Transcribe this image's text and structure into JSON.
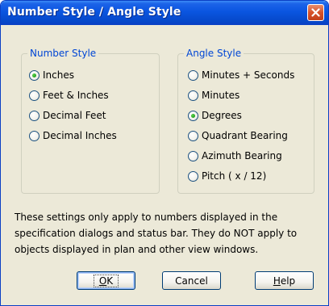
{
  "window": {
    "title": "Number Style / Angle Style"
  },
  "number_style": {
    "label": "Number Style",
    "selected": "Inches",
    "options": [
      "Inches",
      "Feet & Inches",
      "Decimal Feet",
      "Decimal Inches"
    ]
  },
  "angle_style": {
    "label": "Angle Style",
    "selected": "Degrees",
    "options": [
      "Minutes + Seconds",
      "Minutes",
      "Degrees",
      "Quadrant Bearing",
      "Azimuth Bearing",
      "Pitch ( x / 12)"
    ]
  },
  "note": "These settings only apply to numbers displayed in the specification dialogs and status bar. They do NOT apply to objects displayed in plan and other view windows.",
  "buttons": {
    "ok": {
      "label": "OK",
      "mnemonic": "O"
    },
    "cancel": {
      "label": "Cancel"
    },
    "help": {
      "label": "Help",
      "mnemonic": "H"
    }
  },
  "colors": {
    "title_bar": "#0a55e0",
    "close": "#d6522a",
    "group_label": "#0046d5",
    "dialog_bg": "#ece9d8"
  }
}
